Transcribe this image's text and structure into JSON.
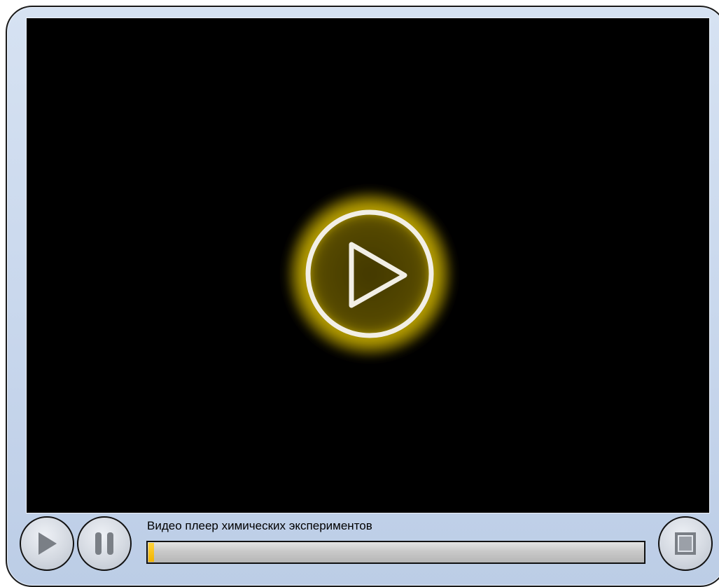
{
  "player": {
    "title": "Видео плеер химических экспериментов",
    "progress_fraction": 0.012,
    "colors": {
      "frame": "#c7d6ec",
      "screen": "#000000",
      "glow": "#e6c800",
      "progress": "#f2b400"
    }
  },
  "controls": {
    "play_icon": "play-icon",
    "pause_icon": "pause-icon",
    "stop_icon": "stop-icon",
    "center_icon": "play-circle-icon"
  }
}
